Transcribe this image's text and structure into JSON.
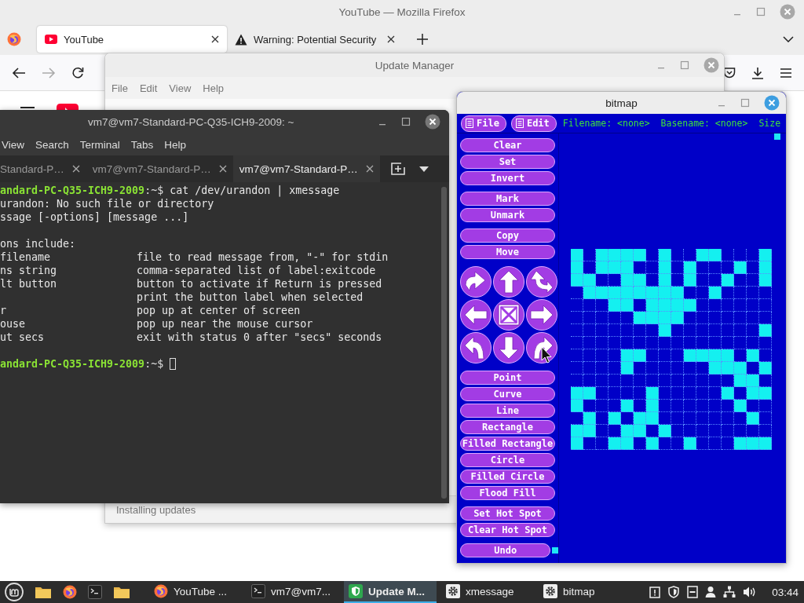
{
  "firefox": {
    "title": "YouTube — Mozilla Firefox",
    "tabs": [
      {
        "label": "YouTube",
        "kind": "youtube",
        "selected": true
      },
      {
        "label": "Warning: Potential Security",
        "kind": "warning",
        "selected": false
      }
    ]
  },
  "update_manager": {
    "title": "Update Manager",
    "menu": [
      "File",
      "Edit",
      "View",
      "Help"
    ],
    "status": "Installing updates"
  },
  "terminal": {
    "title": "vm7@vm7-Standard-PC-Q35-ICH9-2009: ~",
    "menu": [
      "View",
      "Search",
      "Terminal",
      "Tabs",
      "Help"
    ],
    "tabs": [
      {
        "label": "Standard-P…",
        "selected": false
      },
      {
        "label": "vm7@vm7-Standard-P…",
        "selected": false
      },
      {
        "label": "vm7@vm7-Standard-P…",
        "selected": true
      }
    ],
    "lines": [
      {
        "kind": "prompt",
        "host": "andard-PC-Q35-ICH9-2009",
        "path": ":~$",
        "command": "cat /dev/urandon | xmessage",
        "cursor": false
      },
      {
        "kind": "output",
        "text": "urandon: No such file or directory"
      },
      {
        "kind": "output",
        "text": "ssage [-options] [message ...]"
      },
      {
        "kind": "blank"
      },
      {
        "kind": "output",
        "text": "ons include:"
      },
      {
        "kind": "option",
        "option": "filename",
        "description": "file to read message from, \"-\" for stdin"
      },
      {
        "kind": "option",
        "option": "ns string",
        "description": "comma-separated list of label:exitcode"
      },
      {
        "kind": "option",
        "option": "lt button",
        "description": "button to activate if Return is pressed"
      },
      {
        "kind": "option",
        "description": "print the button label when selected"
      },
      {
        "kind": "option",
        "option": "r",
        "description": "pop up at center of screen"
      },
      {
        "kind": "option",
        "option": "ouse",
        "description": "pop up near the mouse cursor"
      },
      {
        "kind": "option",
        "option": "ut secs",
        "description": "exit with status 0 after \"secs\" seconds"
      },
      {
        "kind": "blank"
      },
      {
        "kind": "prompt",
        "host": "andard-PC-Q35-ICH9-2009",
        "path": ":~$",
        "cursor": true
      }
    ]
  },
  "bitmap": {
    "title": "bitmap",
    "menu_buttons": [
      "File",
      "Edit"
    ],
    "info": [
      "Filename: <none>",
      "Basename: <none>",
      "Size"
    ],
    "tool_groups": [
      [
        "Clear",
        "Set",
        "Invert"
      ],
      [
        "Mark",
        "Unmark"
      ],
      [
        "Copy",
        "Move"
      ]
    ],
    "transform_buttons": [
      {
        "kind": "flip_horizontal"
      },
      {
        "kind": "up"
      },
      {
        "kind": "flip_vertical"
      },
      {
        "kind": "left"
      },
      {
        "kind": "fold"
      },
      {
        "kind": "right"
      },
      {
        "kind": "rotate_left"
      },
      {
        "kind": "down"
      },
      {
        "kind": "rotate_right"
      }
    ],
    "draw_tools": [
      "Point",
      "Curve",
      "Line",
      "Rectangle",
      "Filled Rectangle",
      "Circle",
      "Filled Circle",
      "Flood Fill"
    ],
    "hotspot_tools": [
      "Set Hot Spot",
      "Clear Hot Spot"
    ],
    "undo": "Undo",
    "grid": [
      [
        true,
        false,
        true,
        true,
        true,
        true,
        false,
        true,
        false,
        false,
        true,
        true,
        false,
        false,
        false,
        true
      ],
      [
        true,
        false,
        true,
        true,
        true,
        false,
        false,
        true,
        false,
        true,
        false,
        false,
        false,
        true,
        false,
        true
      ],
      [
        true,
        true,
        false,
        false,
        true,
        true,
        false,
        true,
        false,
        true,
        false,
        false,
        true,
        false,
        false,
        true
      ],
      [
        false,
        true,
        true,
        true,
        true,
        true,
        true,
        true,
        true,
        false,
        false,
        true,
        false,
        false,
        false,
        false
      ],
      [
        false,
        false,
        false,
        true,
        true,
        false,
        true,
        true,
        true,
        true,
        false,
        false,
        false,
        false,
        false,
        false
      ],
      [
        false,
        false,
        false,
        false,
        false,
        true,
        true,
        true,
        true,
        false,
        false,
        false,
        false,
        false,
        false,
        false
      ],
      [
        false,
        false,
        false,
        false,
        false,
        false,
        false,
        true,
        false,
        false,
        false,
        false,
        false,
        false,
        false,
        true
      ],
      [
        false,
        false,
        false,
        false,
        false,
        false,
        false,
        false,
        false,
        false,
        false,
        false,
        false,
        false,
        false,
        false
      ],
      [
        false,
        false,
        false,
        false,
        true,
        true,
        false,
        false,
        false,
        true,
        true,
        true,
        true,
        false,
        true,
        false
      ],
      [
        false,
        false,
        false,
        false,
        true,
        false,
        false,
        false,
        false,
        false,
        false,
        true,
        true,
        true,
        false,
        true
      ],
      [
        false,
        false,
        false,
        false,
        false,
        false,
        false,
        false,
        false,
        false,
        false,
        false,
        false,
        true,
        true,
        false
      ],
      [
        true,
        true,
        false,
        false,
        false,
        false,
        true,
        false,
        false,
        false,
        false,
        false,
        true,
        false,
        true,
        true
      ],
      [
        true,
        false,
        false,
        false,
        true,
        false,
        true,
        false,
        false,
        false,
        false,
        false,
        false,
        true,
        false,
        false
      ],
      [
        false,
        true,
        false,
        true,
        false,
        true,
        true,
        false,
        false,
        false,
        false,
        false,
        false,
        false,
        true,
        false
      ],
      [
        true,
        true,
        false,
        false,
        true,
        true,
        false,
        true,
        false,
        false,
        false,
        false,
        false,
        false,
        false,
        false
      ],
      [
        true,
        false,
        false,
        true,
        true,
        false,
        true,
        false,
        false,
        true,
        false,
        false,
        false,
        true,
        true,
        true
      ]
    ]
  },
  "taskbar": {
    "windows": [
      {
        "label": "YouTube ...",
        "kind": "firefox",
        "selected": false
      },
      {
        "label": "vm7@vm7...",
        "kind": "terminal",
        "selected": false
      },
      {
        "label": "Update M...",
        "kind": "shield",
        "selected": true
      },
      {
        "label": "xmessage",
        "kind": "gear",
        "selected": false
      },
      {
        "label": "bitmap",
        "kind": "gear",
        "selected": false
      }
    ],
    "clock": "03:44"
  }
}
